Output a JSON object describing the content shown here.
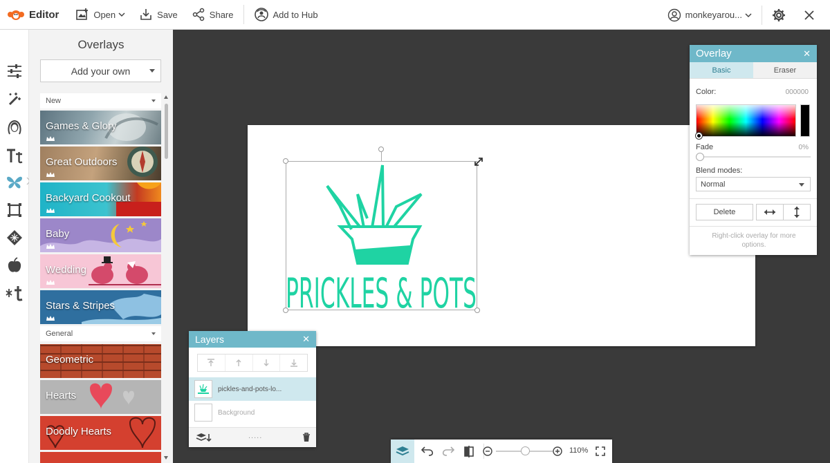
{
  "topbar": {
    "app_name": "Editor",
    "open_label": "Open",
    "save_label": "Save",
    "share_label": "Share",
    "hub_label": "Add to Hub",
    "user_label": "monkeyarou..."
  },
  "rail": {
    "icons": [
      "sliders-icon",
      "magic-wand-icon",
      "face-icon",
      "text-icon",
      "butterfly-icon",
      "frame-icon",
      "texture-icon",
      "apple-icon",
      "seasonal-icon"
    ]
  },
  "overlays_panel": {
    "title": "Overlays",
    "add_own_label": "Add your own",
    "sections": [
      {
        "label": "New",
        "items": [
          "Games & Glory",
          "Great Outdoors",
          "Backyard Cookout",
          "Baby",
          "Wedding",
          "Stars & Stripes"
        ]
      },
      {
        "label": "General",
        "items": [
          "Geometric",
          "Hearts",
          "Doodly Hearts"
        ]
      }
    ]
  },
  "canvas": {
    "logo_text": "PRICKLES & POTS",
    "logo_color": "#1fd3a3"
  },
  "overlay_panel": {
    "title": "Overlay",
    "tabs": [
      "Basic",
      "Eraser"
    ],
    "color_label": "Color:",
    "color_value": "000000",
    "fade_label": "Fade",
    "fade_value": "0%",
    "fade_level": 0,
    "blend_label": "Blend modes:",
    "blend_value": "Normal",
    "delete_label": "Delete",
    "hint": "Right-click overlay for more options."
  },
  "layers_panel": {
    "title": "Layers",
    "layers": [
      "pickles-and-pots-lo...",
      "Background"
    ],
    "footer_dots": "....."
  },
  "bottombar": {
    "zoom_value": "110%"
  },
  "colors": {
    "accent": "#6fb8c9",
    "logo": "#1fd3a3"
  }
}
